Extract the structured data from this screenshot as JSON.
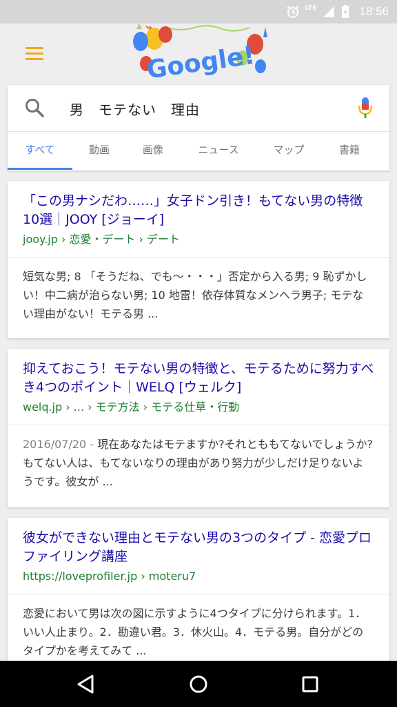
{
  "status_bar": {
    "lte": "LTE",
    "time": "18:56"
  },
  "search": {
    "query": "男　モテない　理由"
  },
  "tabs": [
    {
      "label": "すべて"
    },
    {
      "label": "動画"
    },
    {
      "label": "画像"
    },
    {
      "label": "ニュース"
    },
    {
      "label": "マップ"
    },
    {
      "label": "書籍"
    }
  ],
  "doodle": {
    "text": "Google!"
  },
  "results": [
    {
      "title": "「この男ナシだわ……」女子ドン引き！もてない男の特徴10選｜JOOY [ジョーイ]",
      "url": "jooy.jp › 恋愛・デート › デート",
      "date": "",
      "snippet": "短気な男; 8 「そうだね、でも〜・・・」否定から入る男; 9 恥ずかしい！中二病が治らない男; 10 地雷！依存体質なメンヘラ男子; モテない理由がない！モテる男 ..."
    },
    {
      "title": "抑えておこう！モテない男の特徴と、モテるために努力すべき4つのポイント｜WELQ [ウェルク]",
      "url": "welq.jp › ... › モテ方法 › モテる仕草・行動",
      "date": "2016/07/20 - ",
      "snippet": "現在あなたはモテますか?それとももてないでしょうか?もてない人は、もてないなりの理由があり努力が少しだけ足りないようです。彼女が ..."
    },
    {
      "title": "彼女ができない理由とモテない男の3つのタイプ - 恋愛プロファイリング講座",
      "url": "https://loveprofiler.jp › moteru7",
      "date": "",
      "snippet": "恋愛において男は次の図に示すように4つタイプに分けられます。1．いい人止まり。2．勘違い君。3．休火山。4．モテる男。自分がどのタイプかを考えてみて ..."
    }
  ]
}
